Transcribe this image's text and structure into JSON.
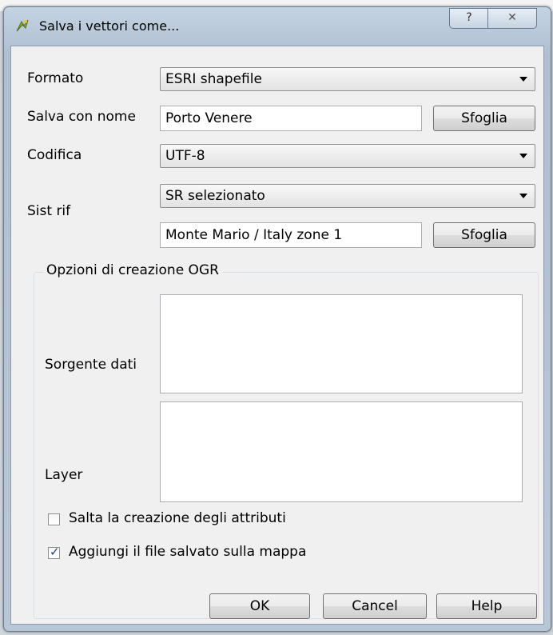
{
  "window": {
    "title": "Salva i vettori come...",
    "help": "?",
    "close": "✕"
  },
  "form": {
    "format_label": "Formato",
    "format_value": "ESRI shapefile",
    "save_as_label": "Salva con nome",
    "save_as_value": "Porto Venere",
    "browse_label": "Sfoglia",
    "encoding_label": "Codifica",
    "encoding_value": "UTF-8",
    "crs_label": "Sist rif",
    "crs_mode_value": "SR selezionato",
    "crs_value": "Monte Mario / Italy zone 1",
    "browse_crs_label": "Sfoglia"
  },
  "ogr": {
    "group_title": "Opzioni di creazione OGR",
    "datasource_label": "Sorgente dati",
    "layer_label": "Layer",
    "skip_attributes_label": "Salta la creazione degli attributi",
    "skip_attributes_checked": false,
    "add_to_map_label": "Aggiungi il file salvato sulla mappa",
    "add_to_map_checked": true,
    "check_mark": "✓"
  },
  "buttons": {
    "ok": "OK",
    "cancel": "Cancel",
    "help": "Help"
  },
  "colors": {
    "titlebar": "#b7c7d8",
    "client": "#f0f0f0",
    "checkmark": "#1f3f8a"
  }
}
